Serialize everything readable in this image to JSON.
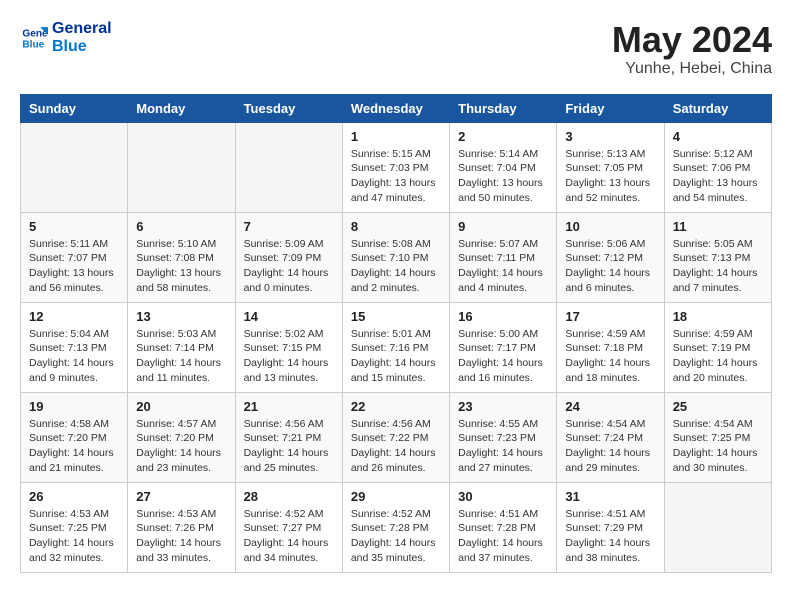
{
  "header": {
    "logo_line1": "General",
    "logo_line2": "Blue",
    "month": "May 2024",
    "location": "Yunhe, Hebei, China"
  },
  "weekdays": [
    "Sunday",
    "Monday",
    "Tuesday",
    "Wednesday",
    "Thursday",
    "Friday",
    "Saturday"
  ],
  "weeks": [
    [
      {
        "day": "",
        "info": ""
      },
      {
        "day": "",
        "info": ""
      },
      {
        "day": "",
        "info": ""
      },
      {
        "day": "1",
        "info": "Sunrise: 5:15 AM\nSunset: 7:03 PM\nDaylight: 13 hours\nand 47 minutes."
      },
      {
        "day": "2",
        "info": "Sunrise: 5:14 AM\nSunset: 7:04 PM\nDaylight: 13 hours\nand 50 minutes."
      },
      {
        "day": "3",
        "info": "Sunrise: 5:13 AM\nSunset: 7:05 PM\nDaylight: 13 hours\nand 52 minutes."
      },
      {
        "day": "4",
        "info": "Sunrise: 5:12 AM\nSunset: 7:06 PM\nDaylight: 13 hours\nand 54 minutes."
      }
    ],
    [
      {
        "day": "5",
        "info": "Sunrise: 5:11 AM\nSunset: 7:07 PM\nDaylight: 13 hours\nand 56 minutes."
      },
      {
        "day": "6",
        "info": "Sunrise: 5:10 AM\nSunset: 7:08 PM\nDaylight: 13 hours\nand 58 minutes."
      },
      {
        "day": "7",
        "info": "Sunrise: 5:09 AM\nSunset: 7:09 PM\nDaylight: 14 hours\nand 0 minutes."
      },
      {
        "day": "8",
        "info": "Sunrise: 5:08 AM\nSunset: 7:10 PM\nDaylight: 14 hours\nand 2 minutes."
      },
      {
        "day": "9",
        "info": "Sunrise: 5:07 AM\nSunset: 7:11 PM\nDaylight: 14 hours\nand 4 minutes."
      },
      {
        "day": "10",
        "info": "Sunrise: 5:06 AM\nSunset: 7:12 PM\nDaylight: 14 hours\nand 6 minutes."
      },
      {
        "day": "11",
        "info": "Sunrise: 5:05 AM\nSunset: 7:13 PM\nDaylight: 14 hours\nand 7 minutes."
      }
    ],
    [
      {
        "day": "12",
        "info": "Sunrise: 5:04 AM\nSunset: 7:13 PM\nDaylight: 14 hours\nand 9 minutes."
      },
      {
        "day": "13",
        "info": "Sunrise: 5:03 AM\nSunset: 7:14 PM\nDaylight: 14 hours\nand 11 minutes."
      },
      {
        "day": "14",
        "info": "Sunrise: 5:02 AM\nSunset: 7:15 PM\nDaylight: 14 hours\nand 13 minutes."
      },
      {
        "day": "15",
        "info": "Sunrise: 5:01 AM\nSunset: 7:16 PM\nDaylight: 14 hours\nand 15 minutes."
      },
      {
        "day": "16",
        "info": "Sunrise: 5:00 AM\nSunset: 7:17 PM\nDaylight: 14 hours\nand 16 minutes."
      },
      {
        "day": "17",
        "info": "Sunrise: 4:59 AM\nSunset: 7:18 PM\nDaylight: 14 hours\nand 18 minutes."
      },
      {
        "day": "18",
        "info": "Sunrise: 4:59 AM\nSunset: 7:19 PM\nDaylight: 14 hours\nand 20 minutes."
      }
    ],
    [
      {
        "day": "19",
        "info": "Sunrise: 4:58 AM\nSunset: 7:20 PM\nDaylight: 14 hours\nand 21 minutes."
      },
      {
        "day": "20",
        "info": "Sunrise: 4:57 AM\nSunset: 7:20 PM\nDaylight: 14 hours\nand 23 minutes."
      },
      {
        "day": "21",
        "info": "Sunrise: 4:56 AM\nSunset: 7:21 PM\nDaylight: 14 hours\nand 25 minutes."
      },
      {
        "day": "22",
        "info": "Sunrise: 4:56 AM\nSunset: 7:22 PM\nDaylight: 14 hours\nand 26 minutes."
      },
      {
        "day": "23",
        "info": "Sunrise: 4:55 AM\nSunset: 7:23 PM\nDaylight: 14 hours\nand 27 minutes."
      },
      {
        "day": "24",
        "info": "Sunrise: 4:54 AM\nSunset: 7:24 PM\nDaylight: 14 hours\nand 29 minutes."
      },
      {
        "day": "25",
        "info": "Sunrise: 4:54 AM\nSunset: 7:25 PM\nDaylight: 14 hours\nand 30 minutes."
      }
    ],
    [
      {
        "day": "26",
        "info": "Sunrise: 4:53 AM\nSunset: 7:25 PM\nDaylight: 14 hours\nand 32 minutes."
      },
      {
        "day": "27",
        "info": "Sunrise: 4:53 AM\nSunset: 7:26 PM\nDaylight: 14 hours\nand 33 minutes."
      },
      {
        "day": "28",
        "info": "Sunrise: 4:52 AM\nSunset: 7:27 PM\nDaylight: 14 hours\nand 34 minutes."
      },
      {
        "day": "29",
        "info": "Sunrise: 4:52 AM\nSunset: 7:28 PM\nDaylight: 14 hours\nand 35 minutes."
      },
      {
        "day": "30",
        "info": "Sunrise: 4:51 AM\nSunset: 7:28 PM\nDaylight: 14 hours\nand 37 minutes."
      },
      {
        "day": "31",
        "info": "Sunrise: 4:51 AM\nSunset: 7:29 PM\nDaylight: 14 hours\nand 38 minutes."
      },
      {
        "day": "",
        "info": ""
      }
    ]
  ]
}
